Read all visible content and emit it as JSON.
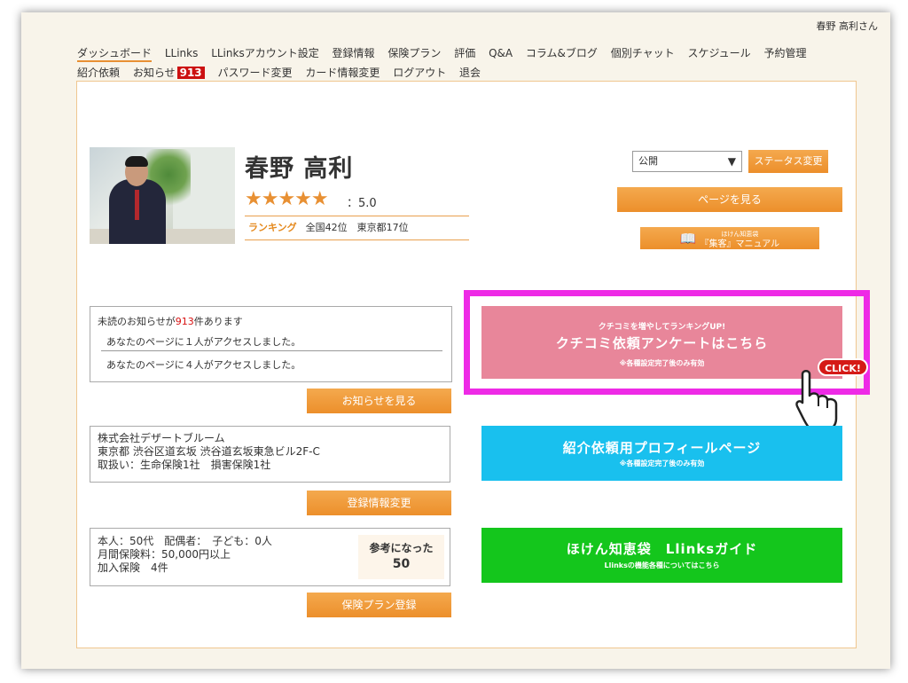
{
  "header": {
    "username": "春野 高利さん"
  },
  "nav": {
    "row1": [
      "ダッシュボード",
      "LLinks",
      "LLinksアカウント設定",
      "登録情報",
      "保険プラン",
      "評価",
      "Q&A",
      "コラム&ブログ",
      "個別チャット",
      "スケジュール",
      "予約管理"
    ],
    "row2_a": "紹介依頼",
    "row2_b": "お知らせ",
    "notice_badge": "913",
    "row2_rest": [
      "パスワード変更",
      "カード情報変更",
      "ログアウト",
      "退会"
    ]
  },
  "profile": {
    "name": "春野 高利",
    "stars": "★★★★★",
    "rating": "：5.0",
    "ranking_label": "ランキング",
    "ranking_text": "全国42位　東京都17位"
  },
  "status": {
    "selected": "公開",
    "change_label": "ステータス変更",
    "view_page_label": "ページを見る",
    "manual_top": "ほけん知恵袋",
    "manual_label": "『集客』マニュアル"
  },
  "notices": {
    "prefix": "未読のお知らせが",
    "count": "913",
    "suffix": "件あります",
    "items": [
      "あなたのページに１人がアクセスしました。",
      "あなたのページに４人がアクセスしました。"
    ],
    "button": "お知らせを見る"
  },
  "company": {
    "lines": [
      "株式会社デザートブルーム",
      "東京都 渋谷区道玄坂 渋谷道玄坂東急ビル2F-C",
      "取扱い：生命保険1社　損害保険1社"
    ],
    "button": "登録情報変更"
  },
  "plan": {
    "lines": [
      "本人：50代　配偶者：　子ども：0人",
      "月間保険料：50,000円以上",
      "加入保険　4件"
    ],
    "helpful_label": "参考になった",
    "helpful_count": "50",
    "button": "保険プラン登録"
  },
  "cta": {
    "review": {
      "top": "クチコミを増やしてランキングUP!",
      "main": "クチコミ依頼アンケートはこちら",
      "note": "※各種設定完了後のみ有効"
    },
    "click": "CLICK!",
    "referral": {
      "main": "紹介依頼用プロフィールページ",
      "note": "※各種設定完了後のみ有効"
    },
    "guide": {
      "main": "ほけん知恵袋　Llinksガイド",
      "note": "Llinksの機能各種についてはこちら"
    }
  },
  "colors": {
    "accent": "#ec8f2b",
    "pink": "#e8869a",
    "blue": "#19c0ee",
    "green": "#14c61c",
    "highlight": "#ee2ae6"
  }
}
